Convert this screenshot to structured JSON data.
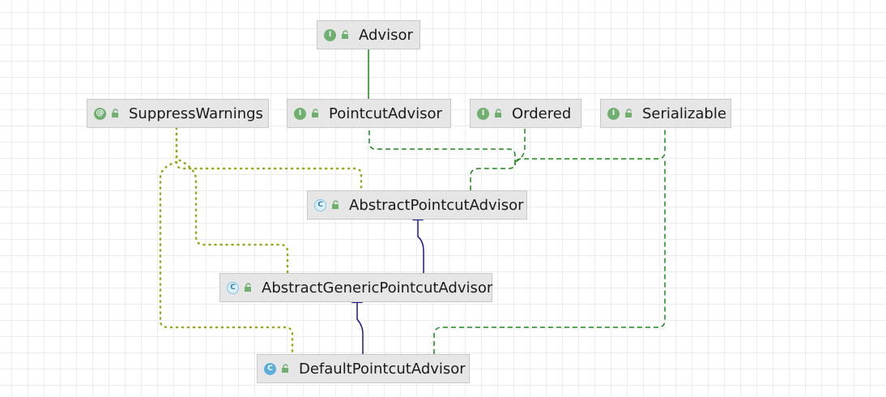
{
  "legend_colors": {
    "extends_interface": "#198a19",
    "implements": "#198a19",
    "extends_class": "#19198a",
    "annotation": "#9aa61b"
  },
  "nodes": {
    "advisor": {
      "label": "Advisor",
      "kind": "interface",
      "badge": "I"
    },
    "suppress_warnings": {
      "label": "SuppressWarnings",
      "kind": "annotation",
      "badge": "@"
    },
    "pointcut_advisor": {
      "label": "PointcutAdvisor",
      "kind": "interface",
      "badge": "I"
    },
    "ordered": {
      "label": "Ordered",
      "kind": "interface",
      "badge": "I"
    },
    "serializable": {
      "label": "Serializable",
      "kind": "interface",
      "badge": "I"
    },
    "abstract_pointcut_advisor": {
      "label": "AbstractPointcutAdvisor",
      "kind": "abstract-class",
      "badge": "C"
    },
    "abstract_generic_pointcut_advisor": {
      "label": "AbstractGenericPointcutAdvisor",
      "kind": "abstract-class",
      "badge": "C"
    },
    "default_pointcut_advisor": {
      "label": "DefaultPointcutAdvisor",
      "kind": "class",
      "badge": "C"
    }
  }
}
